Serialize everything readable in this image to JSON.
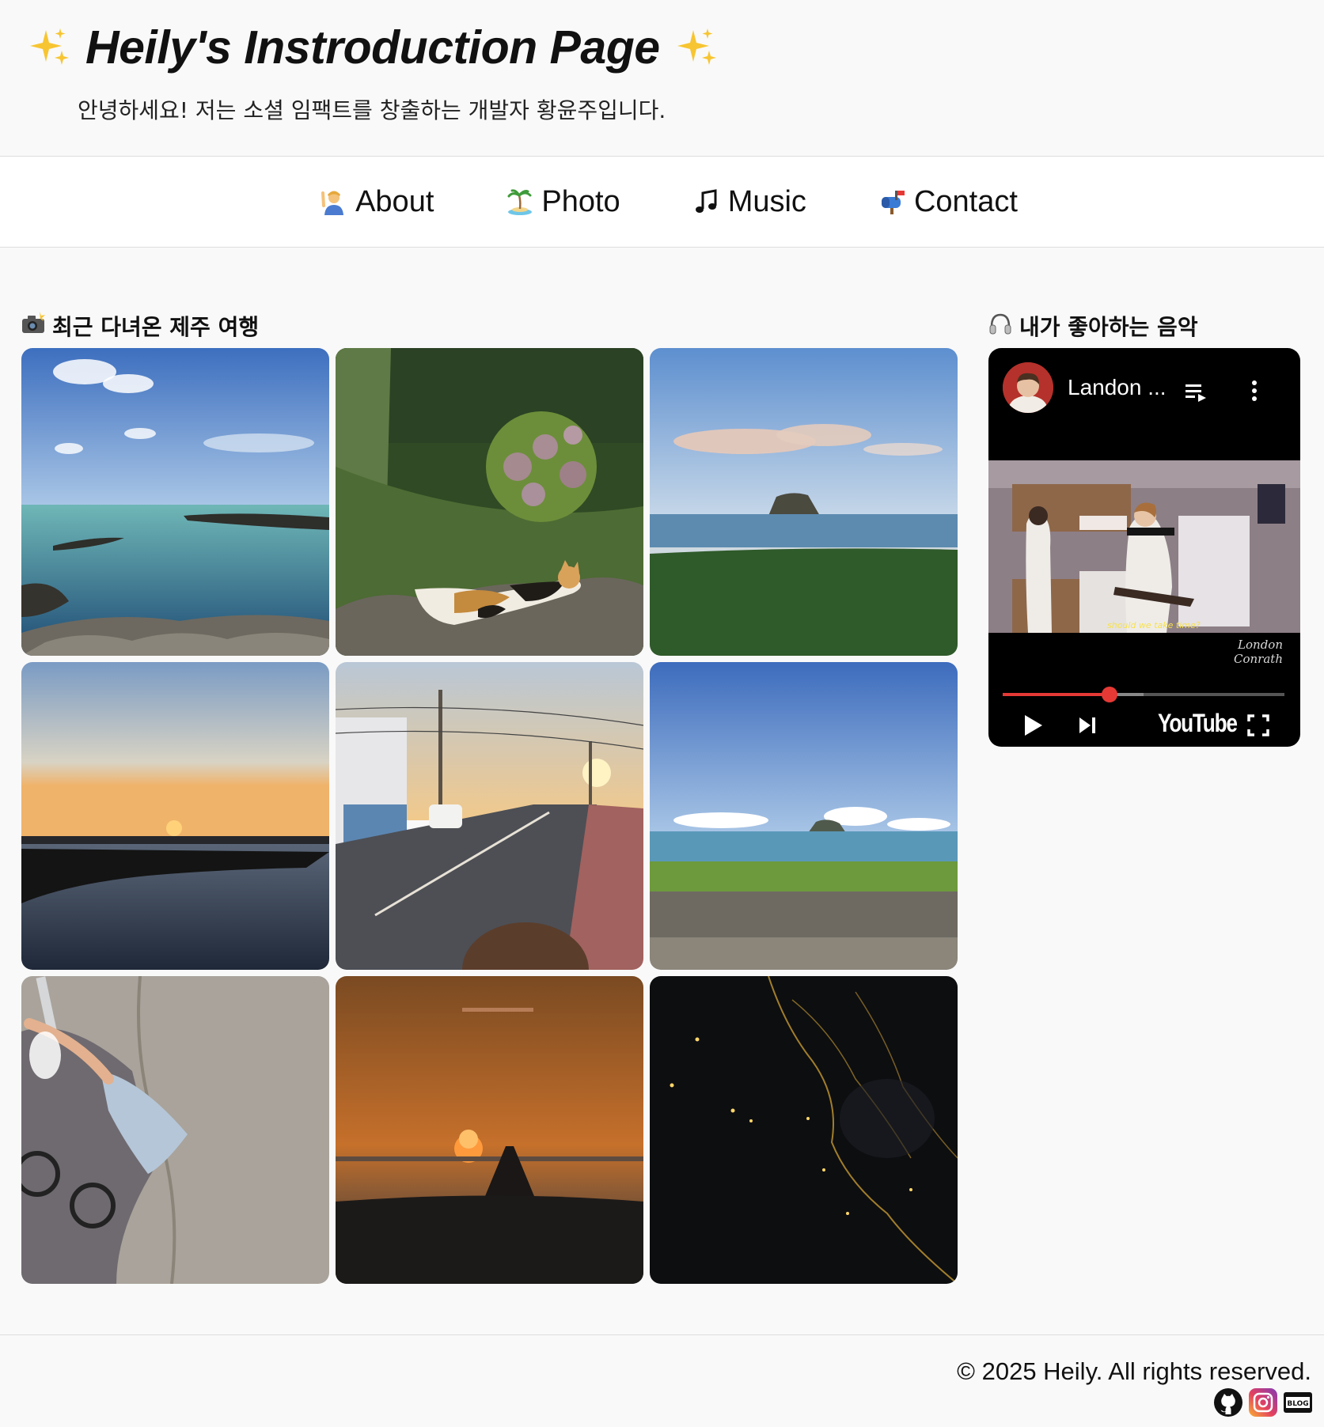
{
  "header": {
    "title": "Heily's Instroduction Page",
    "subtitle": "안녕하세요! 저는 소셜 임팩트를 창출하는 개발자 황윤주입니다.",
    "title_icon": "sparkles-icon"
  },
  "nav": {
    "items": [
      {
        "label": "About",
        "icon": "person-raising-hand-icon"
      },
      {
        "label": "Photo",
        "icon": "desert-island-icon"
      },
      {
        "label": "Music",
        "icon": "musical-note-icon"
      },
      {
        "label": "Contact",
        "icon": "mailbox-icon"
      }
    ]
  },
  "photos": {
    "title": "최근 다녀온 제주 여행",
    "title_icon": "camera-flash-icon",
    "items": [
      "sea-rocks-photo",
      "calico-cat-photo",
      "island-sea-photo",
      "harbor-sunset-photo",
      "street-sunset-photo",
      "beach-island-photo",
      "pavement-selfie-photo",
      "airplane-sunset-photo",
      "night-city-lights-photo"
    ]
  },
  "music": {
    "title": "내가 좋아하는 음악",
    "title_icon": "headphones-icon",
    "player": {
      "video_title": "Landon ...",
      "caption": "should we take time?",
      "channel_mark_line1": "London",
      "channel_mark_line2": "Conrath",
      "brand": "YouTube",
      "progress": 0.38,
      "buffered": 0.5,
      "accent": "#e53935"
    }
  },
  "footer": {
    "copyright": "© 2025 Heily. All rights reserved.",
    "social_icons": [
      "github-icon",
      "instagram-icon",
      "blog-icon"
    ]
  }
}
